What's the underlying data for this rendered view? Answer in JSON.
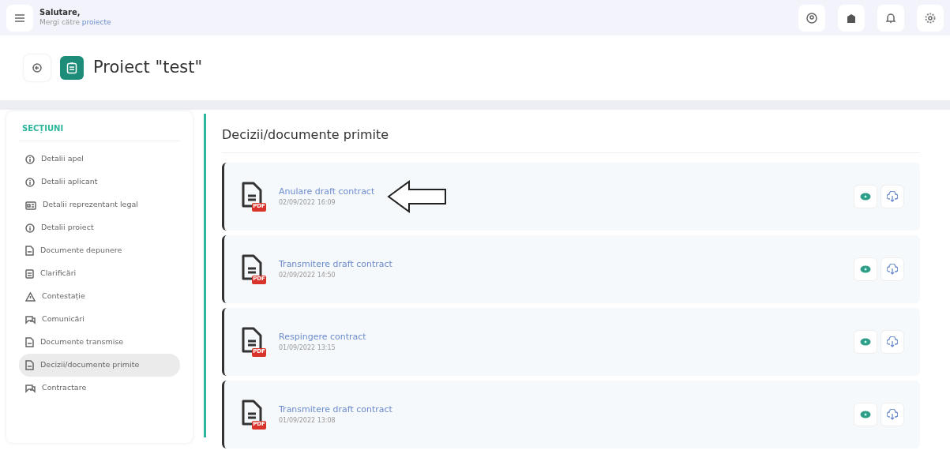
{
  "header": {
    "greeting": "Salutare,",
    "subtitle": "Mergi către",
    "subtitle_link": "proiecte"
  },
  "page_title": "Proiect \"test\"",
  "sidebar": {
    "heading": "SECȚIUNI",
    "items": [
      {
        "label": "Detalii apel",
        "kind": "info",
        "selected": false
      },
      {
        "label": "Detalii aplicant",
        "kind": "info",
        "selected": false
      },
      {
        "label": "Detalii reprezentant legal",
        "kind": "idcard",
        "selected": false
      },
      {
        "label": "Detalii proiect",
        "kind": "info",
        "selected": false
      },
      {
        "label": "Documente depunere",
        "kind": "doc",
        "selected": false
      },
      {
        "label": "Clarificări",
        "kind": "clipboard",
        "selected": false
      },
      {
        "label": "Contestație",
        "kind": "warning",
        "selected": false
      },
      {
        "label": "Comunicări",
        "kind": "chat",
        "selected": false
      },
      {
        "label": "Documente transmise",
        "kind": "doc",
        "selected": false
      },
      {
        "label": "Decizii/documente primite",
        "kind": "doc",
        "selected": true
      },
      {
        "label": "Contractare",
        "kind": "chat",
        "selected": false
      }
    ]
  },
  "section_title": "Decizii/documente primite",
  "documents": [
    {
      "title": "Anulare draft contract",
      "date": "02/09/2022 16:09",
      "badge": "PDF",
      "pointed": true
    },
    {
      "title": "Transmitere draft contract",
      "date": "02/09/2022 14:50",
      "badge": "PDF",
      "pointed": false
    },
    {
      "title": "Respingere contract",
      "date": "01/09/2022 13:15",
      "badge": "PDF",
      "pointed": false
    },
    {
      "title": "Transmitere draft contract",
      "date": "01/09/2022 13:08",
      "badge": "PDF",
      "pointed": false
    }
  ]
}
